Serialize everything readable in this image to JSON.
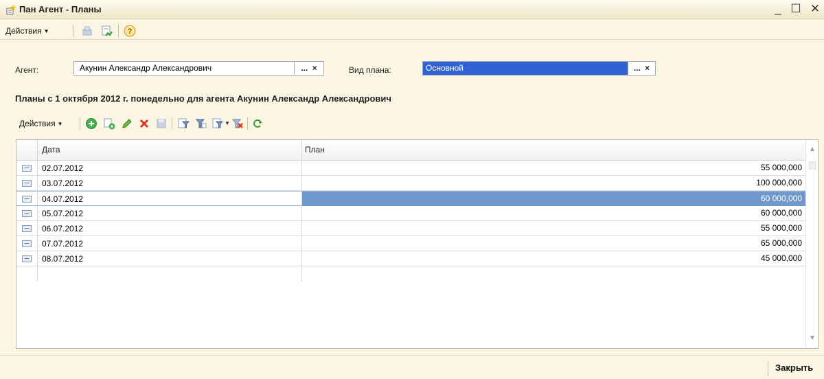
{
  "window": {
    "title": "Пан Агент - Планы",
    "minimize": "_",
    "maximize": "☐",
    "close": "✕"
  },
  "toolbar": {
    "actions_label": "Действия"
  },
  "form": {
    "agent_label": "Агент:",
    "agent_value": "Акунин Александр Александрович",
    "plan_type_label": "Вид плана:",
    "plan_type_value": "Основной",
    "select_button": "...",
    "clear_button": "×"
  },
  "heading": "Планы с 1 октября 2012 г. понедельно для агента Акунин Александр Александрович",
  "table_toolbar": {
    "actions_label": "Действия"
  },
  "table": {
    "columns": [
      "Дата",
      "План"
    ],
    "rows": [
      {
        "date": "02.07.2012",
        "plan": "55 000,000"
      },
      {
        "date": "03.07.2012",
        "plan": "100 000,000"
      },
      {
        "date": "04.07.2012",
        "plan": "60 000,000"
      },
      {
        "date": "05.07.2012",
        "plan": "60 000,000"
      },
      {
        "date": "06.07.2012",
        "plan": "55 000,000"
      },
      {
        "date": "07.07.2012",
        "plan": "65 000,000"
      },
      {
        "date": "08.07.2012",
        "plan": "45 000,000"
      }
    ],
    "active_row": 2
  },
  "footer": {
    "close_label": "Закрыть"
  },
  "colors": {
    "selection": "#7098cc",
    "field_selection": "#3162d4",
    "background": "#fbf6e3"
  },
  "icons": [
    "form-icon",
    "post-icon",
    "report-icon",
    "help-icon",
    "add-icon",
    "copy-icon",
    "edit-icon",
    "delete-icon",
    "save-icon",
    "filter-set-icon",
    "filter-icon",
    "filter-settings-icon",
    "filter-clear-icon",
    "refresh-icon",
    "row-icon"
  ]
}
